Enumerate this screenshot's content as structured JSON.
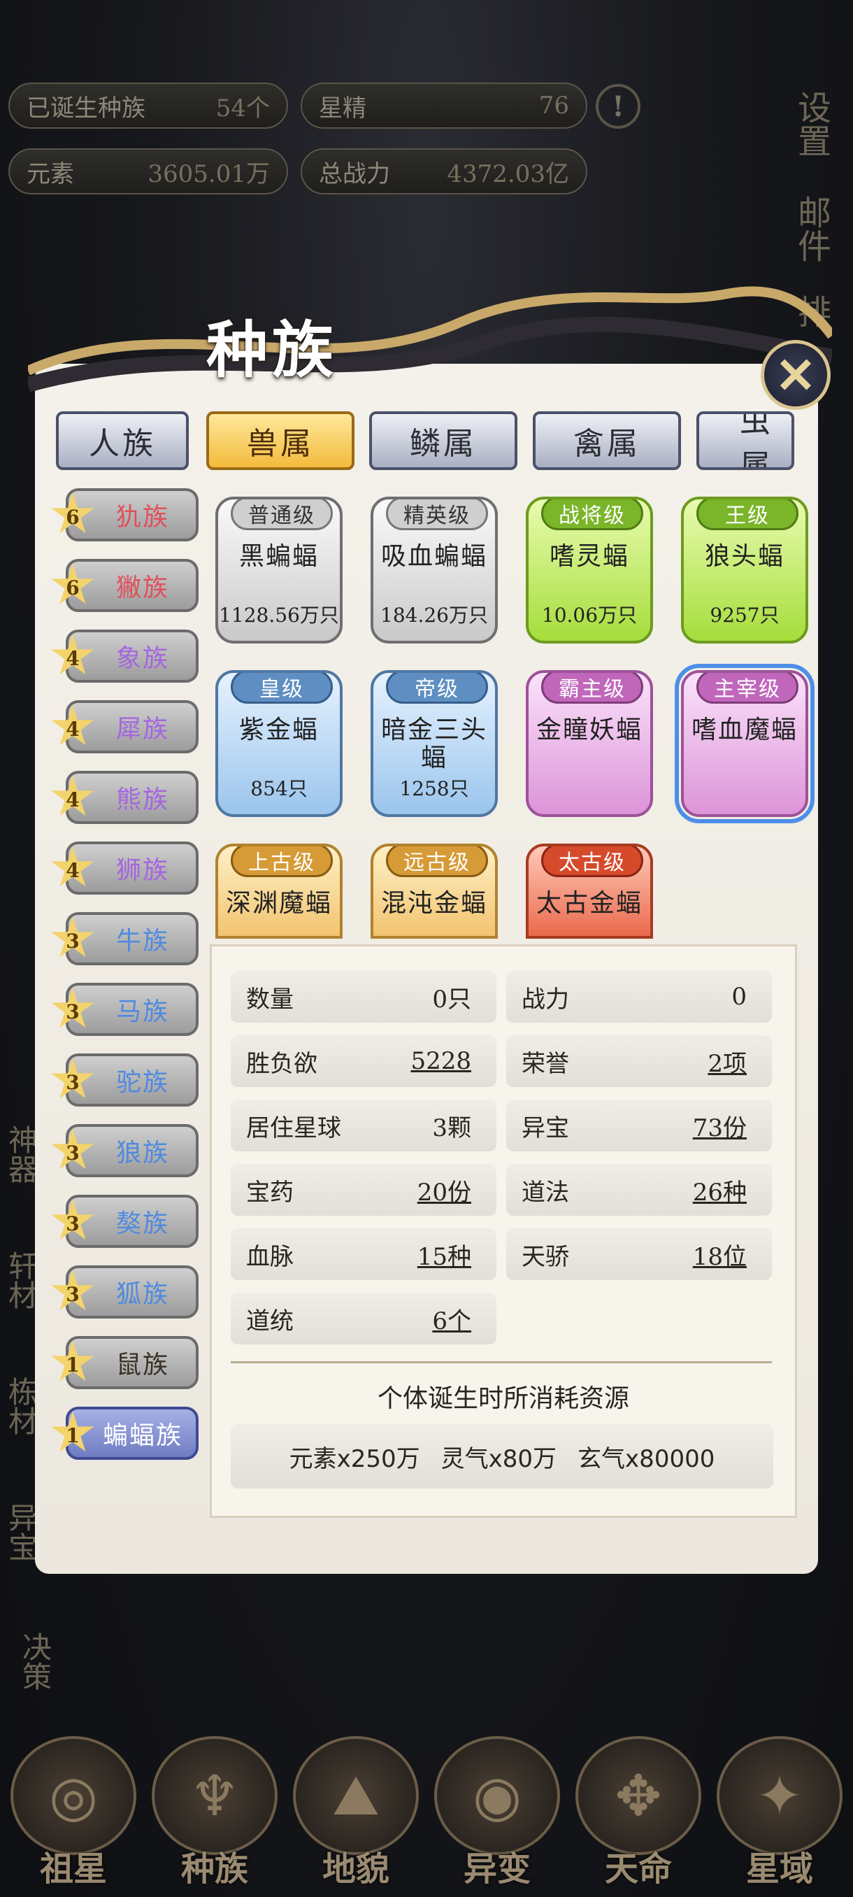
{
  "top_bar": {
    "born_races_label": "已诞生种族",
    "born_races_value": "54个",
    "star_essence_label": "星精",
    "star_essence_value": "76",
    "element_label": "元素",
    "element_value": "3605.01万",
    "total_power_label": "总战力",
    "total_power_value": "4372.03亿",
    "alert_glyph": "!"
  },
  "right_menu": [
    "设置",
    "邮件",
    "排"
  ],
  "left_side_labels": [
    "神器",
    "轩材",
    "栋材",
    "异宝",
    "决策"
  ],
  "panel": {
    "title": "种族",
    "close_glyph": "✕",
    "tabs": [
      "人族",
      "兽属",
      "鳞属",
      "禽属",
      "虫属"
    ],
    "active_tab": "兽属",
    "races": [
      {
        "stars": "6",
        "name": "犰族"
      },
      {
        "stars": "6",
        "name": "獙族"
      },
      {
        "stars": "4",
        "name": "象族"
      },
      {
        "stars": "4",
        "name": "犀族"
      },
      {
        "stars": "4",
        "name": "熊族"
      },
      {
        "stars": "4",
        "name": "狮族"
      },
      {
        "stars": "3",
        "name": "牛族"
      },
      {
        "stars": "3",
        "name": "马族"
      },
      {
        "stars": "3",
        "name": "驼族"
      },
      {
        "stars": "3",
        "name": "狼族"
      },
      {
        "stars": "3",
        "name": "獒族"
      },
      {
        "stars": "3",
        "name": "狐族"
      },
      {
        "stars": "1",
        "name": "鼠族"
      },
      {
        "stars": "1",
        "name": "蝙蝠族"
      }
    ],
    "selected_race": "蝙蝠族",
    "race_colors": {
      "red": "#e0505a",
      "purple": "#a565e0",
      "blue": "#4f8ae0",
      "dark": "#3a3226"
    },
    "units": [
      {
        "rank": "普通级",
        "name": "黑蝙蝠",
        "count": "1128.56万只"
      },
      {
        "rank": "精英级",
        "name": "吸血蝙蝠",
        "count": "184.26万只"
      },
      {
        "rank": "战将级",
        "name": "嗜灵蝠",
        "count": "10.06万只"
      },
      {
        "rank": "王级",
        "name": "狼头蝠",
        "count": "9257只"
      },
      {
        "rank": "皇级",
        "name": "紫金蝠",
        "count": "854只"
      },
      {
        "rank": "帝级",
        "name": "暗金三头蝠",
        "count": "1258只"
      },
      {
        "rank": "霸主级",
        "name": "金瞳妖蝠",
        "count": ""
      },
      {
        "rank": "主宰级",
        "name": "嗜血魔蝠",
        "count": ""
      },
      {
        "rank": "上古级",
        "name": "深渊魔蝠",
        "count": ""
      },
      {
        "rank": "远古级",
        "name": "混沌金蝠",
        "count": ""
      },
      {
        "rank": "太古级",
        "name": "太古金蝠",
        "count": ""
      }
    ],
    "stats": [
      {
        "label": "数量",
        "value": "0只"
      },
      {
        "label": "战力",
        "value": "0"
      },
      {
        "label": "胜负欲",
        "value": "5228"
      },
      {
        "label": "荣誉",
        "value": "2项"
      },
      {
        "label": "居住星球",
        "value": "3颗"
      },
      {
        "label": "异宝",
        "value": "73份"
      },
      {
        "label": "宝药",
        "value": "20份"
      },
      {
        "label": "道法",
        "value": "26种"
      },
      {
        "label": "血脉",
        "value": "15种"
      },
      {
        "label": "天骄",
        "value": "18位"
      },
      {
        "label": "道统",
        "value": "6个"
      }
    ],
    "cost_title": "个体诞生时所消耗资源",
    "costs": [
      "元素x250万",
      "灵气x80万",
      "玄气x80000"
    ]
  },
  "bottom_nav": [
    {
      "label": "祖星",
      "glyph": "◎"
    },
    {
      "label": "种族",
      "glyph": "♆"
    },
    {
      "label": "地貌",
      "glyph": "⛰"
    },
    {
      "label": "异变",
      "glyph": "◉"
    },
    {
      "label": "天命",
      "glyph": "✥"
    },
    {
      "label": "星域",
      "glyph": "✦"
    }
  ]
}
